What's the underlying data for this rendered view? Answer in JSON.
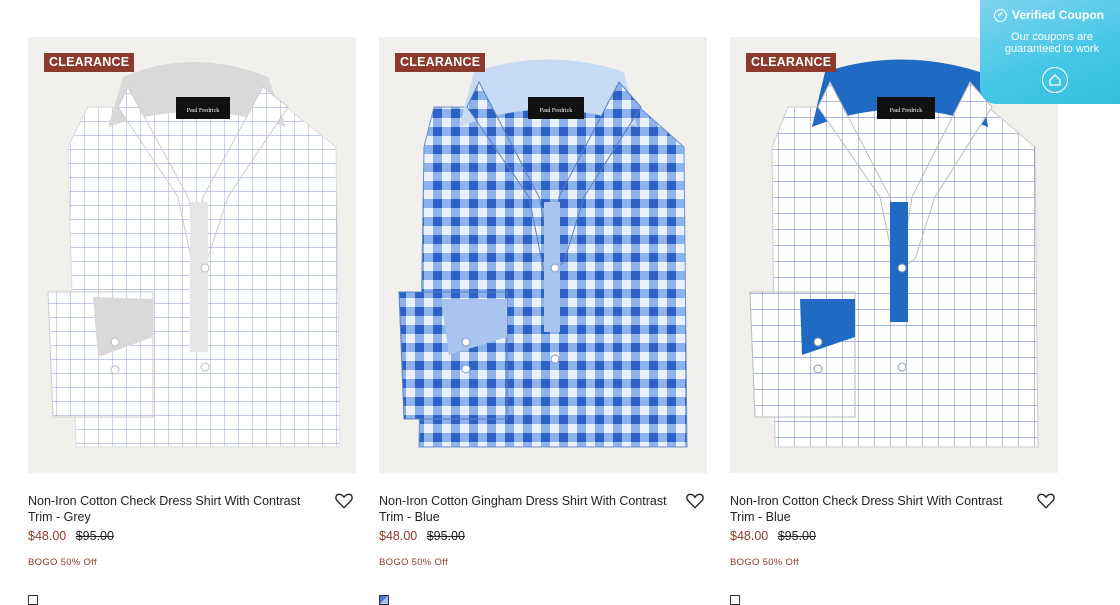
{
  "products": [
    {
      "badge": "CLEARANCE",
      "title": "Non-Iron Cotton Check Dress Shirt With Contrast Trim - Grey",
      "sale_price": "$48.00",
      "original_price": "$95.00",
      "promo": "BOGO 50% Off",
      "brand_label": "Paul Fredrick",
      "color": "#c9c9c9"
    },
    {
      "badge": "CLEARANCE",
      "title": "Non-Iron Cotton Gingham Dress Shirt With Contrast Trim - Blue",
      "sale_price": "$48.00",
      "original_price": "$95.00",
      "promo": "BOGO 50% Off",
      "brand_label": "Paul Fredrick",
      "color": "#4a82d9"
    },
    {
      "badge": "CLEARANCE",
      "title": "Non-Iron Cotton Check Dress Shirt With Contrast Trim - Blue",
      "sale_price": "$48.00",
      "original_price": "$95.00",
      "promo": "BOGO 50% Off",
      "brand_label": "Paul Fredrick",
      "color": "#1f6bc4"
    }
  ],
  "coupon": {
    "title": "Verified Coupon",
    "text": "Our coupons are guaranteed to work"
  },
  "colors": {
    "clearance_badge": "#8b3a2b",
    "sale_price": "#8b3a2b",
    "coupon_bg": "#42c7e5"
  }
}
